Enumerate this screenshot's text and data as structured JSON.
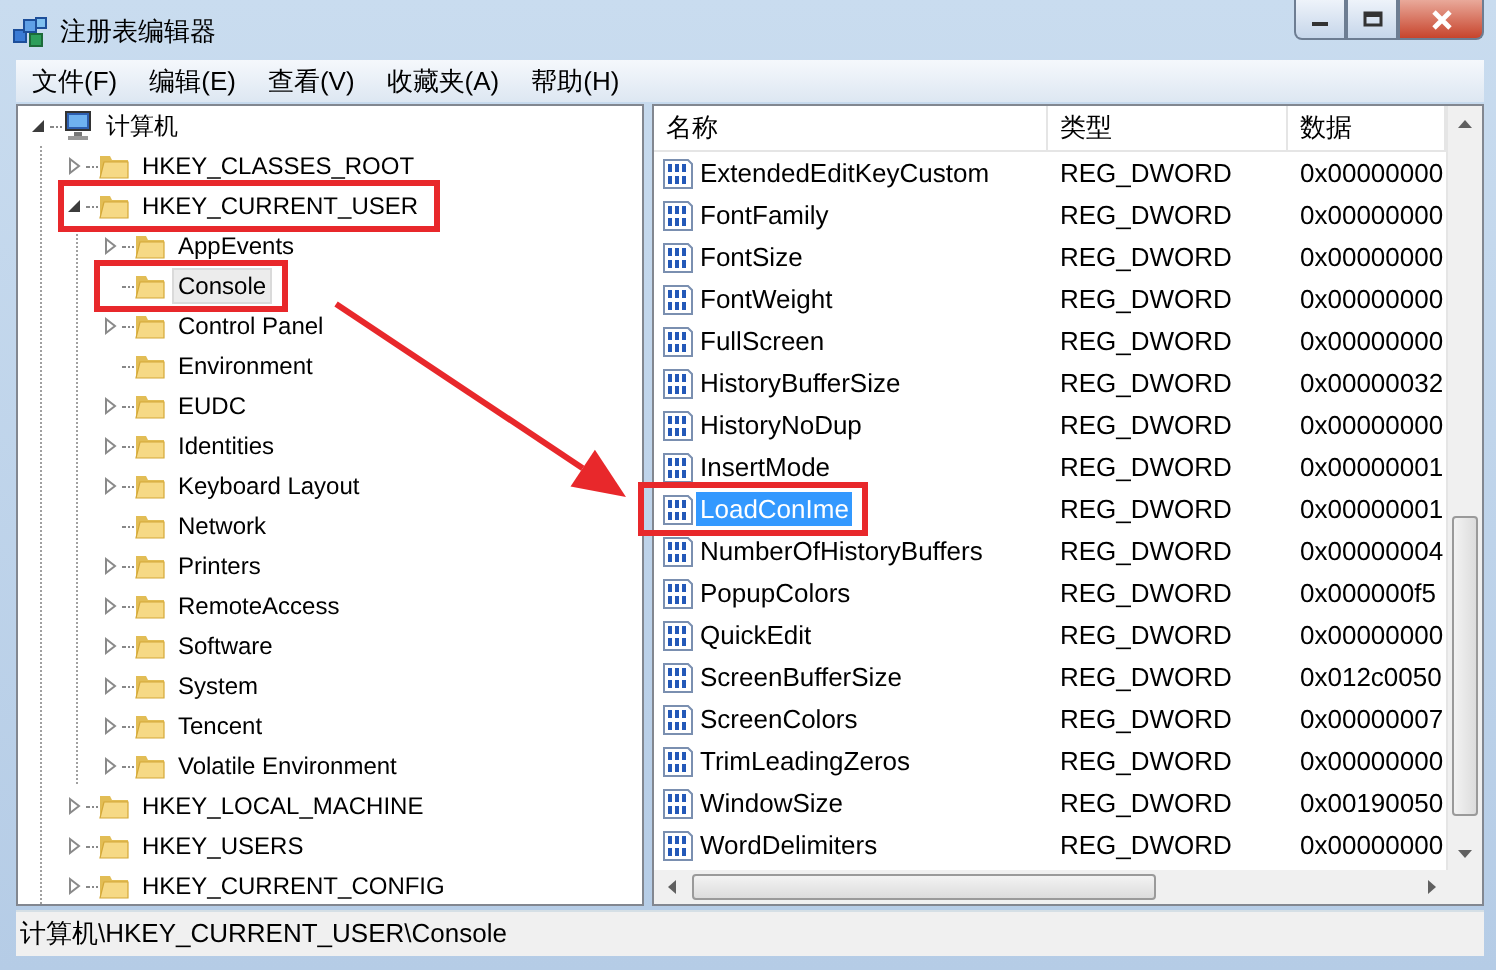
{
  "window": {
    "title": "注册表编辑器"
  },
  "menu": [
    "文件(F)",
    "编辑(E)",
    "查看(V)",
    "收藏夹(A)",
    "帮助(H)"
  ],
  "tree": [
    {
      "label": "计算机",
      "kind": "branch",
      "expanded": true,
      "selected": false,
      "highlighted": false,
      "children": [
        {
          "label": "HKEY_CLASSES_ROOT",
          "kind": "branch",
          "expanded": false,
          "selected": false,
          "highlighted": false
        },
        {
          "label": "HKEY_CURRENT_USER",
          "kind": "branch",
          "expanded": true,
          "selected": false,
          "highlighted": true,
          "children": [
            {
              "label": "AppEvents",
              "kind": "branch",
              "expanded": false,
              "selected": false,
              "highlighted": false
            },
            {
              "label": "Console",
              "kind": "leaf",
              "selected": true,
              "highlighted": true
            },
            {
              "label": "Control Panel",
              "kind": "branch",
              "expanded": false,
              "selected": false,
              "highlighted": false
            },
            {
              "label": "Environment",
              "kind": "leaf",
              "selected": false,
              "highlighted": false
            },
            {
              "label": "EUDC",
              "kind": "branch",
              "expanded": false,
              "selected": false,
              "highlighted": false
            },
            {
              "label": "Identities",
              "kind": "branch",
              "expanded": false,
              "selected": false,
              "highlighted": false
            },
            {
              "label": "Keyboard Layout",
              "kind": "branch",
              "expanded": false,
              "selected": false,
              "highlighted": false
            },
            {
              "label": "Network",
              "kind": "leaf",
              "selected": false,
              "highlighted": false
            },
            {
              "label": "Printers",
              "kind": "branch",
              "expanded": false,
              "selected": false,
              "highlighted": false
            },
            {
              "label": "RemoteAccess",
              "kind": "branch",
              "expanded": false,
              "selected": false,
              "highlighted": false
            },
            {
              "label": "Software",
              "kind": "branch",
              "expanded": false,
              "selected": false,
              "highlighted": false
            },
            {
              "label": "System",
              "kind": "branch",
              "expanded": false,
              "selected": false,
              "highlighted": false
            },
            {
              "label": "Tencent",
              "kind": "branch",
              "expanded": false,
              "selected": false,
              "highlighted": false
            },
            {
              "label": "Volatile Environment",
              "kind": "branch",
              "expanded": false,
              "selected": false,
              "highlighted": false
            }
          ]
        },
        {
          "label": "HKEY_LOCAL_MACHINE",
          "kind": "branch",
          "expanded": false,
          "selected": false,
          "highlighted": false
        },
        {
          "label": "HKEY_USERS",
          "kind": "branch",
          "expanded": false,
          "selected": false,
          "highlighted": false
        },
        {
          "label": "HKEY_CURRENT_CONFIG",
          "kind": "branch",
          "expanded": false,
          "selected": false,
          "highlighted": false
        }
      ]
    }
  ],
  "values": {
    "columns": [
      "名称",
      "类型",
      "数据"
    ],
    "rows": [
      {
        "name": "ExtendedEditKeyCustom",
        "type": "REG_DWORD",
        "data": "0x00000000",
        "selected": false,
        "highlighted": false
      },
      {
        "name": "FontFamily",
        "type": "REG_DWORD",
        "data": "0x00000000",
        "selected": false,
        "highlighted": false
      },
      {
        "name": "FontSize",
        "type": "REG_DWORD",
        "data": "0x00000000",
        "selected": false,
        "highlighted": false
      },
      {
        "name": "FontWeight",
        "type": "REG_DWORD",
        "data": "0x00000000",
        "selected": false,
        "highlighted": false
      },
      {
        "name": "FullScreen",
        "type": "REG_DWORD",
        "data": "0x00000000",
        "selected": false,
        "highlighted": false
      },
      {
        "name": "HistoryBufferSize",
        "type": "REG_DWORD",
        "data": "0x00000032",
        "selected": false,
        "highlighted": false
      },
      {
        "name": "HistoryNoDup",
        "type": "REG_DWORD",
        "data": "0x00000000",
        "selected": false,
        "highlighted": false
      },
      {
        "name": "InsertMode",
        "type": "REG_DWORD",
        "data": "0x00000001",
        "selected": false,
        "highlighted": false
      },
      {
        "name": "LoadConIme",
        "type": "REG_DWORD",
        "data": "0x00000001",
        "selected": true,
        "highlighted": true
      },
      {
        "name": "NumberOfHistoryBuffers",
        "type": "REG_DWORD",
        "data": "0x00000004",
        "selected": false,
        "highlighted": false
      },
      {
        "name": "PopupColors",
        "type": "REG_DWORD",
        "data": "0x000000f5",
        "selected": false,
        "highlighted": false
      },
      {
        "name": "QuickEdit",
        "type": "REG_DWORD",
        "data": "0x00000000",
        "selected": false,
        "highlighted": false
      },
      {
        "name": "ScreenBufferSize",
        "type": "REG_DWORD",
        "data": "0x012c0050",
        "selected": false,
        "highlighted": false
      },
      {
        "name": "ScreenColors",
        "type": "REG_DWORD",
        "data": "0x00000007",
        "selected": false,
        "highlighted": false
      },
      {
        "name": "TrimLeadingZeros",
        "type": "REG_DWORD",
        "data": "0x00000000",
        "selected": false,
        "highlighted": false
      },
      {
        "name": "WindowSize",
        "type": "REG_DWORD",
        "data": "0x00190050",
        "selected": false,
        "highlighted": false
      },
      {
        "name": "WordDelimiters",
        "type": "REG_DWORD",
        "data": "0x00000000",
        "selected": false,
        "highlighted": false
      }
    ]
  },
  "annotations": {
    "arrow": true
  },
  "status_bar": "计算机\\HKEY_CURRENT_USER\\Console"
}
